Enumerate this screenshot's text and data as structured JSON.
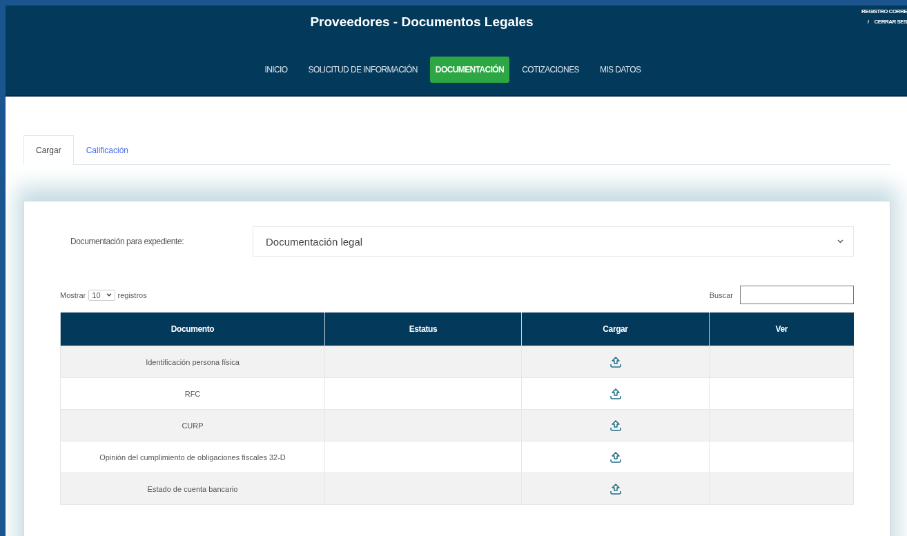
{
  "header": {
    "title": "Proveedores - Documentos Legales",
    "user_links": [
      "REGISTRO CORRE",
      "CERRAR SES"
    ],
    "link_separator": "/"
  },
  "nav": [
    {
      "label": "INICIO",
      "selected": false
    },
    {
      "label": "SOLICITUD DE INFORMACIÓN",
      "selected": false
    },
    {
      "label": "DOCUMENTACIÓN",
      "selected": true
    },
    {
      "label": "COTIZACIONES",
      "selected": false
    },
    {
      "label": "MIS DATOS",
      "selected": false
    }
  ],
  "tabs": [
    {
      "label": "Cargar",
      "selected": true
    },
    {
      "label": "Calificación",
      "selected": false
    }
  ],
  "filter": {
    "label": "Documentación para expediente:",
    "value": "Documentación legal"
  },
  "length": {
    "before": "Mostrar",
    "value": "10",
    "after": "registros"
  },
  "search": {
    "label": "Buscar"
  },
  "table": {
    "columns": [
      "Documento",
      "Estatus",
      "Cargar",
      "Ver"
    ],
    "rows": [
      {
        "document": "Identificación persona física"
      },
      {
        "document": "RFC"
      },
      {
        "document": "CURP"
      },
      {
        "document": "Opinión del cumplimiento de obligaciones fiscales 32-D"
      },
      {
        "document": "Estado de cuenta bancario"
      }
    ]
  }
}
